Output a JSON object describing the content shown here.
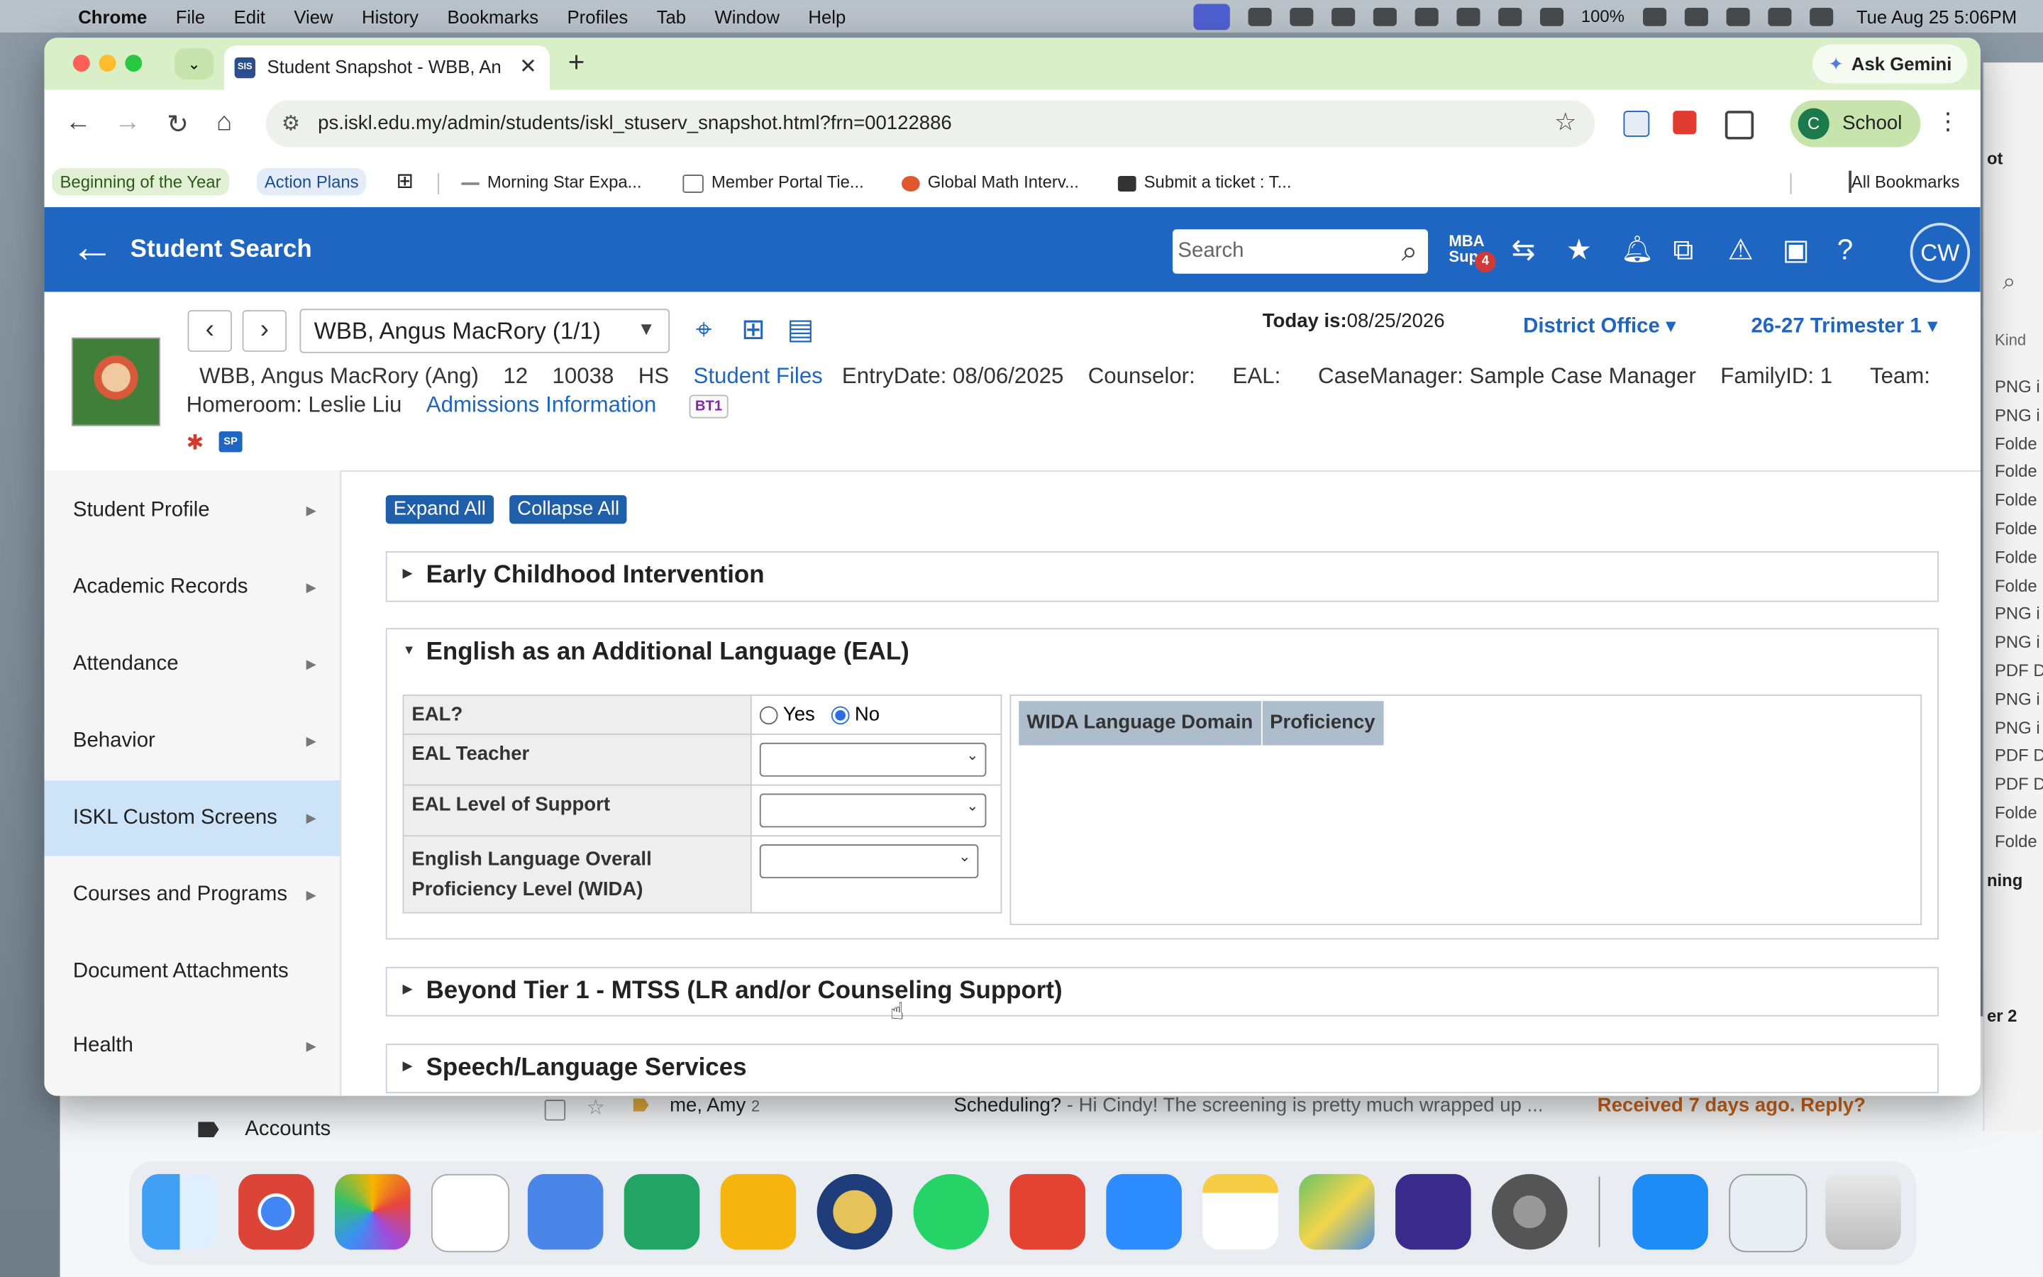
{
  "menubar": {
    "app": "Chrome",
    "menus": [
      "File",
      "Edit",
      "View",
      "History",
      "Bookmarks",
      "Profiles",
      "Tab",
      "Window",
      "Help"
    ],
    "battery": "100%",
    "clock": "Tue Aug 25  5:06PM"
  },
  "browser": {
    "tab_title": "Student Snapshot - WBB, Ang",
    "tab_favicon": "SIS",
    "url": "ps.iskl.edu.my/admin/students/iskl_stuserv_snapshot.html?frn=00122886",
    "ask_gemini": "Ask Gemini",
    "profile_initial": "C",
    "profile_label": "School",
    "bookmarks": [
      {
        "label": "Beginning of the Year"
      },
      {
        "label": "Action Plans"
      },
      {
        "label": "Morning Star Expa..."
      },
      {
        "label": "Member Portal Tie..."
      },
      {
        "label": "Global Math Interv..."
      },
      {
        "label": "Submit a ticket : T..."
      }
    ],
    "all_bookmarks": "All Bookmarks"
  },
  "header": {
    "title": "Student Search",
    "search_placeholder": "Search",
    "mba_line1": "MBA",
    "mba_line2": "Supp",
    "mba_badge": "4",
    "avatar": "CW"
  },
  "student": {
    "selector": "WBB, Angus MacRory  (1/1)",
    "today_label": "Today is:",
    "today_value": "08/25/2026",
    "office": "District Office",
    "term": "26-27 Trimester 1",
    "name": "WBB, Angus MacRory (Ang)",
    "grade": "12",
    "id": "10038",
    "school": "HS",
    "student_files": "Student Files",
    "entry_date": "EntryDate: 08/06/2025",
    "counselor": "Counselor:",
    "eal": "EAL:",
    "case_manager": "CaseManager: Sample Case Manager",
    "family_id": "FamilyID: 1",
    "team": "Team:",
    "homeroom": "Homeroom: Leslie Liu",
    "admissions": "Admissions Information",
    "bt1": "BT1",
    "sp": "SP"
  },
  "sidebar": {
    "items": [
      {
        "label": "Student Profile",
        "arrow": true
      },
      {
        "label": "Academic Records",
        "arrow": true
      },
      {
        "label": "Attendance",
        "arrow": true
      },
      {
        "label": "Behavior",
        "arrow": true
      },
      {
        "label": "ISKL Custom Screens",
        "arrow": true
      },
      {
        "label": "Courses and Programs",
        "arrow": true
      },
      {
        "label": "Document Attachments",
        "arrow": false
      },
      {
        "label": "Health",
        "arrow": true
      }
    ]
  },
  "content": {
    "expand_all": "Expand All",
    "collapse_all": "Collapse All",
    "sections": [
      {
        "title": "Early Childhood Intervention"
      },
      {
        "title": "English as an Additional Language (EAL)"
      },
      {
        "title": "Beyond Tier 1 - MTSS (LR and/or Counseling Support)"
      },
      {
        "title": "Speech/Language Services"
      }
    ],
    "eal": {
      "q_eal": "EAL?",
      "yes": "Yes",
      "no": "No",
      "teacher": "EAL Teacher",
      "support": "EAL Level of Support",
      "wida_line1": "English Language Overall",
      "wida_line2": "Proficiency Level (WIDA)",
      "wida_col1": "WIDA Language Domain",
      "wida_col2": "Proficiency"
    }
  },
  "background": {
    "accounts": "Accounts",
    "mail_from": "me, Amy",
    "mail_count": "2",
    "mail_subject": "Scheduling?",
    "mail_snippet": " - Hi Cindy! The screening is pretty much wrapped up ...",
    "mail_nudge": "Received 7 days ago. Reply?",
    "finder_kind": "Kind",
    "finder_items": [
      "PNG i",
      "PNG i",
      "Folde",
      "Folde",
      "Folde",
      "Folde",
      "Folde",
      "Folde",
      "PNG i",
      "PNG i",
      "PDF D",
      "PNG i",
      "PNG i",
      "PDF D",
      "PDF D",
      "Folde",
      "Folde"
    ],
    "frag1": "ot",
    "frag2": "ning",
    "frag3": "er 2"
  },
  "colors": {
    "ps_blue": "#1f66c2",
    "tab_green": "#d9efc7",
    "nav_active": "#cde3f8"
  }
}
